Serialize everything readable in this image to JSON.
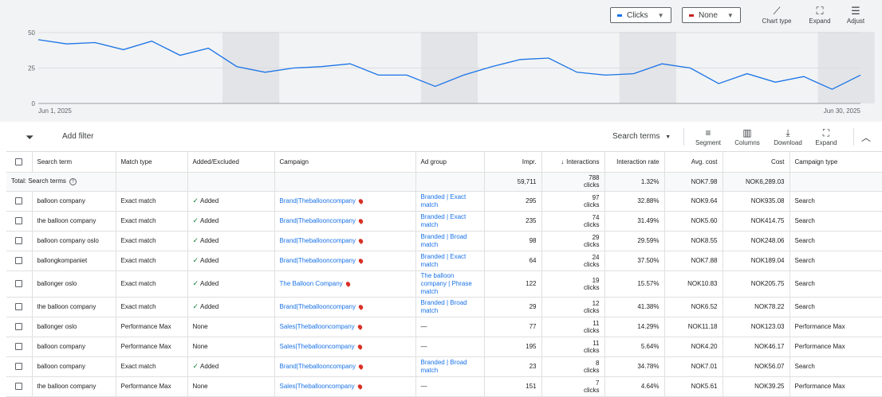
{
  "chart": {
    "metric1": {
      "label": "Clicks",
      "color": "#1a73e8"
    },
    "metric2": {
      "label": "None",
      "color": "#c5221f"
    },
    "tools": [
      {
        "name": "chart-type",
        "label": "Chart type",
        "icon": "trend-icon"
      },
      {
        "name": "expand",
        "label": "Expand",
        "icon": "expand-icon"
      },
      {
        "name": "adjust",
        "label": "Adjust",
        "icon": "sliders-icon"
      }
    ]
  },
  "chart_data": {
    "type": "line",
    "series": [
      {
        "name": "Clicks",
        "values": [
          45,
          42,
          43,
          38,
          44,
          34,
          39,
          26,
          22,
          25,
          26,
          28,
          20,
          20,
          12,
          20,
          26,
          31,
          32,
          22,
          20,
          21,
          28,
          25,
          14,
          21,
          15,
          19,
          10,
          20
        ]
      }
    ],
    "x_start": "Jun 1, 2025",
    "x_end": "Jun 30, 2025",
    "ylim": [
      0,
      50
    ],
    "yticks": [
      "50",
      "25",
      "0"
    ],
    "shaded_weekends": [
      [
        7,
        8
      ],
      [
        14,
        15
      ],
      [
        21,
        22
      ],
      [
        28,
        29
      ]
    ],
    "grid": true
  },
  "toolbar": {
    "add_filter": "Add filter",
    "segment_select": "Search terms",
    "tools": [
      {
        "name": "segment",
        "label": "Segment",
        "icon": "segment-icon"
      },
      {
        "name": "columns",
        "label": "Columns",
        "icon": "columns-icon"
      },
      {
        "name": "download",
        "label": "Download",
        "icon": "download-icon"
      },
      {
        "name": "expand",
        "label": "Expand",
        "icon": "expand-icon"
      }
    ]
  },
  "table": {
    "headers": {
      "search_term": "Search term",
      "match_type": "Match type",
      "added_excluded": "Added/Excluded",
      "campaign": "Campaign",
      "ad_group": "Ad group",
      "impr": "Impr.",
      "interactions": "Interactions",
      "interaction_rate": "Interaction rate",
      "avg_cost": "Avg. cost",
      "cost": "Cost",
      "campaign_type": "Campaign type"
    },
    "total": {
      "label": "Total: Search terms",
      "impr": "59,711",
      "interactions": "788",
      "interactions_unit": "clicks",
      "interaction_rate": "1.32%",
      "avg_cost": "NOK7.98",
      "cost": "NOK6,289.03"
    },
    "rows": [
      {
        "search_term": "balloon company",
        "match_type": "Exact match",
        "added_excluded": "Added",
        "campaign": "Brand|Theballooncompany",
        "ad_group": "Branded | Exact match",
        "impr": "295",
        "interactions": "97",
        "unit": "clicks",
        "interaction_rate": "32.88%",
        "avg_cost": "NOK9.64",
        "cost": "NOK935.08",
        "campaign_type": "Search"
      },
      {
        "search_term": "the balloon company",
        "match_type": "Exact match",
        "added_excluded": "Added",
        "campaign": "Brand|Theballooncompany",
        "ad_group": "Branded | Exact match",
        "impr": "235",
        "interactions": "74",
        "unit": "clicks",
        "interaction_rate": "31.49%",
        "avg_cost": "NOK5.60",
        "cost": "NOK414.75",
        "campaign_type": "Search"
      },
      {
        "search_term": "balloon company oslo",
        "match_type": "Exact match",
        "added_excluded": "Added",
        "campaign": "Brand|Theballooncompany",
        "ad_group": "Branded | Broad match",
        "impr": "98",
        "interactions": "29",
        "unit": "clicks",
        "interaction_rate": "29.59%",
        "avg_cost": "NOK8.55",
        "cost": "NOK248.06",
        "campaign_type": "Search"
      },
      {
        "search_term": "ballongkompaniet",
        "match_type": "Exact match",
        "added_excluded": "Added",
        "campaign": "Brand|Theballooncompany",
        "ad_group": "Branded | Exact match",
        "impr": "64",
        "interactions": "24",
        "unit": "clicks",
        "interaction_rate": "37.50%",
        "avg_cost": "NOK7.88",
        "cost": "NOK189.04",
        "campaign_type": "Search"
      },
      {
        "search_term": "ballonger oslo",
        "match_type": "Exact match",
        "added_excluded": "Added",
        "campaign": "The Balloon Company",
        "ad_group": "The balloon company | Phrase match",
        "impr": "122",
        "interactions": "19",
        "unit": "clicks",
        "interaction_rate": "15.57%",
        "avg_cost": "NOK10.83",
        "cost": "NOK205.75",
        "campaign_type": "Search"
      },
      {
        "search_term": "the balloon company",
        "match_type": "Exact match",
        "added_excluded": "Added",
        "campaign": "Brand|Theballooncompany",
        "ad_group": "Branded | Broad match",
        "impr": "29",
        "interactions": "12",
        "unit": "clicks",
        "interaction_rate": "41.38%",
        "avg_cost": "NOK6.52",
        "cost": "NOK78.22",
        "campaign_type": "Search"
      },
      {
        "search_term": "ballonger oslo",
        "match_type": "Performance Max",
        "added_excluded": "None",
        "campaign": "Sales|Theballooncompany",
        "ad_group": "—",
        "impr": "77",
        "interactions": "11",
        "unit": "clicks",
        "interaction_rate": "14.29%",
        "avg_cost": "NOK11.18",
        "cost": "NOK123.03",
        "campaign_type": "Performance Max"
      },
      {
        "search_term": "balloon company",
        "match_type": "Performance Max",
        "added_excluded": "None",
        "campaign": "Sales|Theballooncompany",
        "ad_group": "—",
        "impr": "195",
        "interactions": "11",
        "unit": "clicks",
        "interaction_rate": "5.64%",
        "avg_cost": "NOK4.20",
        "cost": "NOK46.17",
        "campaign_type": "Performance Max"
      },
      {
        "search_term": "balloon company",
        "match_type": "Exact match",
        "added_excluded": "Added",
        "campaign": "Brand|Theballooncompany",
        "ad_group": "Branded | Broad match",
        "impr": "23",
        "interactions": "8",
        "unit": "clicks",
        "interaction_rate": "34.78%",
        "avg_cost": "NOK7.01",
        "cost": "NOK56.07",
        "campaign_type": "Search"
      },
      {
        "search_term": "the balloon company",
        "match_type": "Performance Max",
        "added_excluded": "None",
        "campaign": "Sales|Theballooncompany",
        "ad_group": "—",
        "impr": "151",
        "interactions": "7",
        "unit": "clicks",
        "interaction_rate": "4.64%",
        "avg_cost": "NOK5.61",
        "cost": "NOK39.25",
        "campaign_type": "Performance Max"
      }
    ]
  }
}
